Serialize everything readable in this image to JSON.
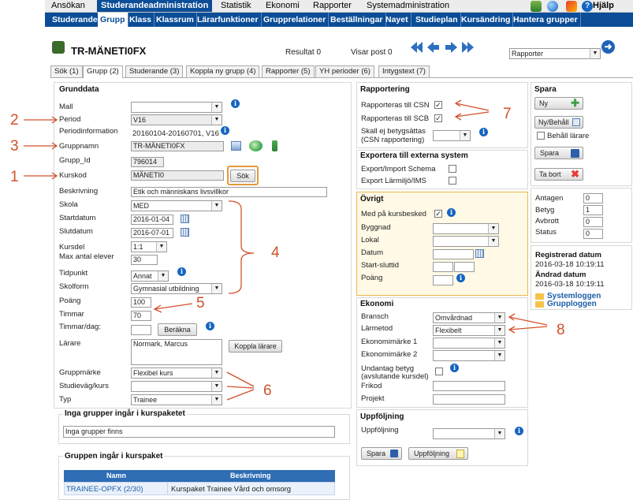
{
  "top_menu": [
    "Ansökan",
    "Studerandeadministration",
    "Statistik",
    "Ekonomi",
    "Rapporter",
    "Systemadministration"
  ],
  "help": "Hjälp",
  "sub_nav": [
    "Studerande",
    "Grupp",
    "Klass",
    "Klassrum",
    "Lärarfunktioner",
    "Grupprelationer",
    "Beställningar",
    "Nayet",
    "Studieplan",
    "Kursändring",
    "Hantera grupper"
  ],
  "title": "TR-MÄNETI0FX",
  "result": "Resultat 0",
  "showing": "Visar post 0",
  "report_select": "Rapporter",
  "tabs": [
    "Sök (1)",
    "Grupp (2)",
    "Studerande (3)",
    "Koppla ny grupp (4)",
    "Rapporter (5)",
    "YH perioder (6)",
    "Intygstext (7)"
  ],
  "grunddata": {
    "heading": "Grunddata",
    "labels": {
      "mall": "Mall",
      "period": "Period",
      "periodinfo": "Periodinformation",
      "gruppnamn": "Gruppnamn",
      "grupp_id": "Grupp_Id",
      "kurskod": "Kurskod",
      "beskrivning": "Beskrivning",
      "skola": "Skola",
      "startdatum": "Startdatum",
      "slutdatum": "Slutdatum",
      "kursdel": "Kursdel",
      "max_elever": "Max antal elever",
      "tidpunkt": "Tidpunkt",
      "skolform": "Skolform",
      "poang": "Poäng",
      "timmar": "Timmar",
      "timmar_dag": "Timmar/dag:",
      "larare": "Lärare",
      "gruppmarke": "Gruppmärke",
      "studievag": "Studieväg/kurs",
      "typ": "Typ"
    },
    "values": {
      "mall": "",
      "period": "V16",
      "periodinfo": "20160104-20160701, V16",
      "gruppnamn": "TR-MÄNETI0FX",
      "grupp_id": "796014",
      "kurskod": "MÄNETI0",
      "beskrivning": "Etik och människans livsvillkor",
      "skola": "MED",
      "startdatum": "2016-01-04",
      "slutdatum": "2016-07-01",
      "kursdel": "1:1",
      "max_elever": "30",
      "tidpunkt": "Annat",
      "skolform": "Gymnasial utbildning",
      "poang": "100",
      "timmar": "70",
      "timmar_dag": "",
      "larare": "Normark, Marcus",
      "gruppmarke": "Flexibel kurs",
      "studievag": "",
      "typ": "Trainee"
    },
    "buttons": {
      "sok": "Sök",
      "berakna": "Beräkna",
      "koppla_larare": "Koppla lärare"
    }
  },
  "inga_grupper": {
    "heading": "Inga grupper ingår i kurspaketet",
    "text": "Inga grupper finns"
  },
  "kurspaket": {
    "heading": "Gruppen ingår i kurspaket",
    "columns": [
      "Namn",
      "Beskrivning"
    ],
    "rows": [
      [
        "TRAINEE-OPFX (2/30)",
        "Kurspaket Trainee Vård och omsorg"
      ]
    ]
  },
  "rapportering": {
    "heading": "Rapportering",
    "items": [
      {
        "label": "Rapporteras till CSN",
        "checked": "✓"
      },
      {
        "label": "Rapporteras till SCB",
        "checked": "✓"
      }
    ],
    "betyg_label_1": "Skall ej betygsättas",
    "betyg_label_2": "(CSN rapportering)"
  },
  "export": {
    "heading": "Exportera till externa system",
    "items": [
      "Export/Import Schema",
      "Export Lärmiljö/IMS"
    ]
  },
  "ovrigt": {
    "heading": "Övrigt",
    "kursbesked": "Med på kursbesked",
    "kursbesked_checked": "✓",
    "labels": [
      "Byggnad",
      "Lokal",
      "Datum",
      "Start-sluttid",
      "Poäng"
    ]
  },
  "ekonomi": {
    "heading": "Ekonomi",
    "bransch_label": "Bransch",
    "bransch": "Omvårdnad",
    "larmetod_label": "Lärmetod",
    "larmetod": "Flexibelt",
    "em1": "Ekonomimärke 1",
    "em2": "Ekonomimärke 2",
    "undantag_1": "Undantag betyg",
    "undantag_2": "(avslutande kursdel)",
    "frikod": "Frikod",
    "projekt": "Projekt"
  },
  "uppfoljning": {
    "heading": "Uppföljning",
    "label": "Uppföljning",
    "spara": "Spara",
    "uppf_btn": "Uppföljning"
  },
  "spara_panel": {
    "heading": "Spara",
    "ny": "Ny",
    "ny_behall": "Ny/Behåll",
    "behall_larare": "Behåll lärare",
    "spara": "Spara",
    "ta_bort": "Ta bort"
  },
  "stats": [
    {
      "label": "Antagen",
      "value": "0"
    },
    {
      "label": "Betyg",
      "value": "1"
    },
    {
      "label": "Avbrott",
      "value": "0"
    },
    {
      "label": "Status",
      "value": "0"
    }
  ],
  "registered": {
    "reg_label": "Registrerad datum",
    "reg": "2016-03-18 10:19:11",
    "chg_label": "Ändrad datum",
    "chg": "2016-03-18 10:19:11",
    "links": [
      "Systemloggen",
      "Grupploggen"
    ]
  },
  "annotations": [
    "2",
    "3",
    "1",
    "4",
    "5",
    "6",
    "7",
    "8"
  ],
  "colors": {
    "nav": "#0b4d97",
    "annotation": "#d2502a",
    "highlight_border": "#e8b84a",
    "highlight_bg": "#fff9e6"
  }
}
